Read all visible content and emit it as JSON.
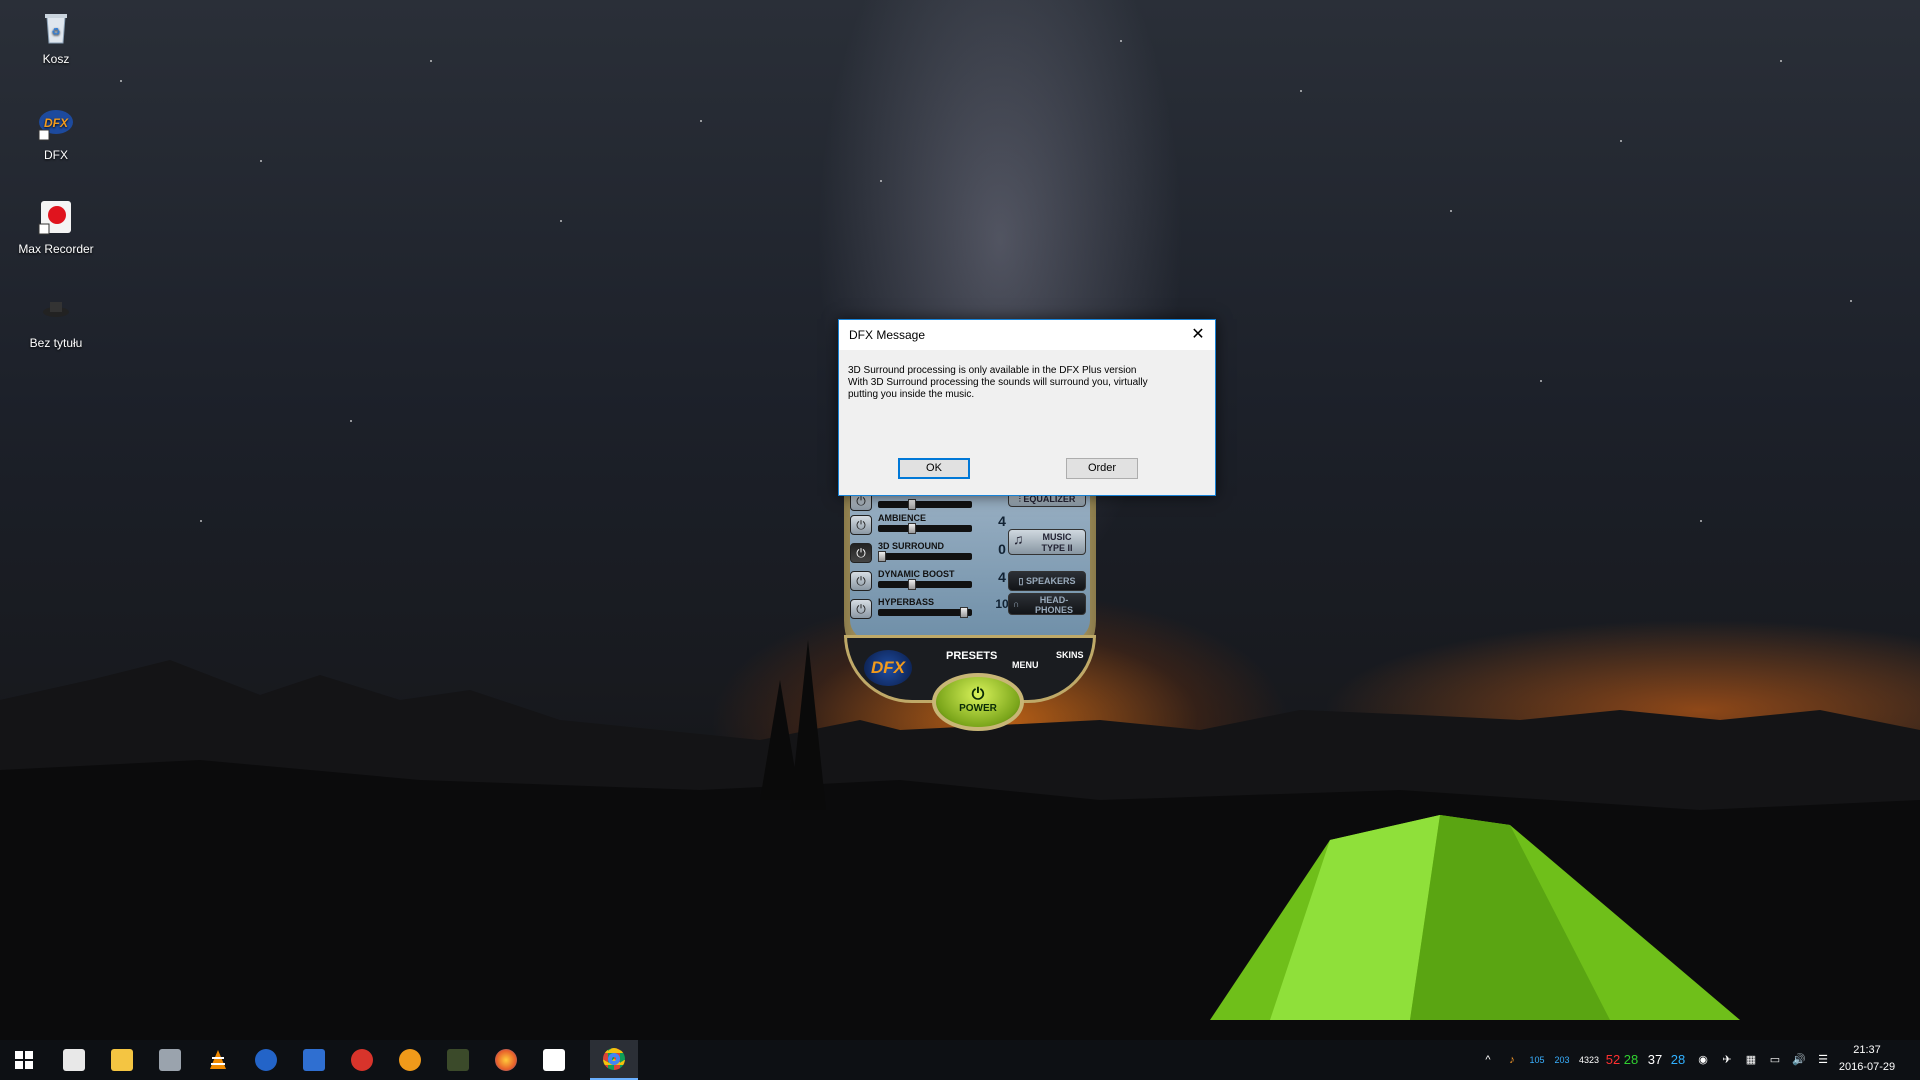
{
  "desktop": {
    "icons": [
      {
        "label": "Kosz",
        "icon": "recycle-bin-icon"
      },
      {
        "label": "DFX",
        "icon": "dfx-app-icon"
      },
      {
        "label": "Max Recorder",
        "icon": "max-recorder-icon"
      },
      {
        "label": "Bez tytułu",
        "icon": "file-icon"
      }
    ]
  },
  "dfx": {
    "logo": "DFX",
    "sliders": [
      {
        "label": "",
        "value": "",
        "level": 0.35
      },
      {
        "label": "AMBIENCE",
        "value": "4",
        "level": 0.35
      },
      {
        "label": "3D SURROUND",
        "value": "0",
        "level": 0.0
      },
      {
        "label": "DYNAMIC BOOST",
        "value": "4",
        "level": 0.35
      },
      {
        "label": "HYPERBASS",
        "value": "10",
        "level": 0.95
      }
    ],
    "right_buttons": {
      "equalizer": "EQUALIZER",
      "music_type_line1": "MUSIC",
      "music_type_line2": "TYPE II",
      "speakers": "SPEAKERS",
      "headphones_line1": "HEAD-",
      "headphones_line2": "PHONES"
    },
    "presets": "PRESETS",
    "menu": "MENU",
    "skins": "SKINS",
    "power": "POWER"
  },
  "dialog": {
    "title": "DFX Message",
    "line1": "3D Surround processing is only available in the DFX Plus version",
    "line2": "With 3D Surround processing the sounds will surround you, virtually",
    "line3": "putting you inside the music.",
    "ok": "OK",
    "order": "Order"
  },
  "taskbar": {
    "apps": [
      "start-icon",
      "movie-maker-icon",
      "file-explorer-icon",
      "tools-icon",
      "vlc-icon",
      "malwarebytes-icon",
      "save-app-icon",
      "ccleaner-icon",
      "media-player-icon",
      "gps-app-icon",
      "firefox-icon",
      "mail-icon",
      "chrome-icon"
    ],
    "tray_numbers": [
      "105",
      "203",
      "4323",
      "52",
      "28",
      "37",
      "28"
    ],
    "tray_colors": [
      "#3ab0ff",
      "#3ab0ff",
      "#ffffff",
      "#ff3030",
      "#30d030",
      "#ffffff",
      "#30b0ff"
    ],
    "time": "21:37",
    "date": "2016-07-29"
  },
  "colors": {
    "accent": "#0078d7",
    "dialog_border": "#1883d7"
  }
}
